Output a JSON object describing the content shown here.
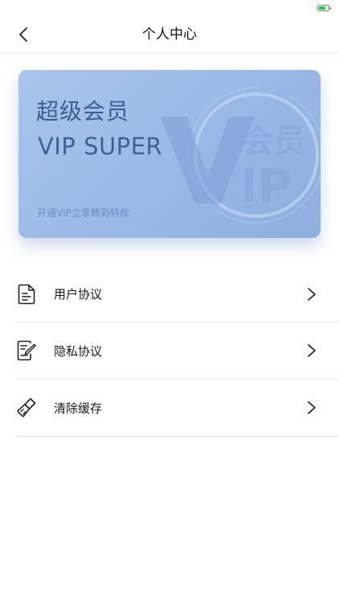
{
  "header": {
    "title": "个人中心",
    "back_icon": "chevron-left-icon"
  },
  "vip_card": {
    "title": "超级会员",
    "subtitle": "VIP SUPER",
    "description": "开通VIP立享精彩特权",
    "watermark_text": "会员",
    "watermark_vip": "IP"
  },
  "menu": {
    "items": [
      {
        "label": "用户协议",
        "icon": "document-icon"
      },
      {
        "label": "隐私协议",
        "icon": "edit-document-icon"
      },
      {
        "label": "清除缓存",
        "icon": "broom-icon"
      }
    ]
  },
  "colors": {
    "card_start": "#a9c4ec",
    "card_end": "#8faee0",
    "card_text": "#3a5f92",
    "battery": "#33c24d",
    "divider": "#e6e6e6"
  }
}
